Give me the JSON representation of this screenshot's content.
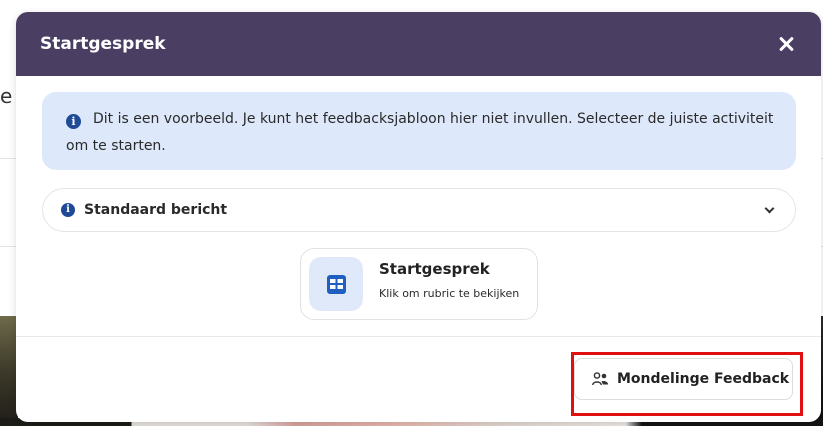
{
  "background": {
    "partial_text": "e"
  },
  "modal": {
    "title": "Startgesprek",
    "info_message": "Dit is een voorbeeld. Je kunt het feedbacksjabloon hier niet invullen. Selecteer de juiste activiteit om te starten.",
    "accordion_label": "Standaard bericht",
    "card": {
      "title": "Startgesprek",
      "subtitle": "Klik om rubric te bekijken"
    },
    "feedback_button_label": "Mondelinge Feedback"
  },
  "colors": {
    "header": "#4a3f63",
    "info_bg": "#dde9fb",
    "accent_blue": "#1f4a95",
    "highlight": "#e01010"
  }
}
